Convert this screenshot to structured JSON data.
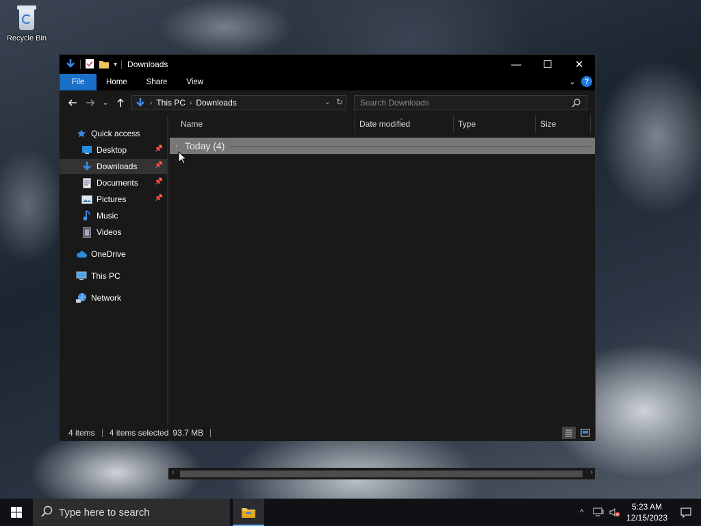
{
  "desktop": {
    "icons": [
      {
        "label": "Recycle Bin",
        "icon": "recycle-bin-icon"
      }
    ]
  },
  "window": {
    "title": "Downloads",
    "controls": {
      "minimize": "—",
      "maximize": "☐",
      "close": "✕"
    },
    "ribbon_tabs": [
      "File",
      "Home",
      "Share",
      "View"
    ],
    "help": "?",
    "address": {
      "crumbs": [
        "This PC",
        "Downloads"
      ]
    },
    "search": {
      "placeholder": "Search Downloads"
    },
    "nav": {
      "quick_access": "Quick access",
      "items": [
        {
          "label": "Desktop",
          "icon": "desktop-icon",
          "pinned": true
        },
        {
          "label": "Downloads",
          "icon": "downloads-icon",
          "pinned": true,
          "selected": true
        },
        {
          "label": "Documents",
          "icon": "documents-icon",
          "pinned": true
        },
        {
          "label": "Pictures",
          "icon": "pictures-icon",
          "pinned": true
        },
        {
          "label": "Music",
          "icon": "music-icon",
          "pinned": false
        },
        {
          "label": "Videos",
          "icon": "videos-icon",
          "pinned": false
        }
      ],
      "onedrive": "OneDrive",
      "this_pc": "This PC",
      "network": "Network"
    },
    "columns": [
      "Name",
      "Date modified",
      "Type",
      "Size"
    ],
    "group": {
      "label": "Today (4)"
    },
    "status": {
      "items": "4 items",
      "selected": "4 items selected",
      "size": "93.7 MB"
    }
  },
  "taskbar": {
    "search_placeholder": "Type here to search",
    "clock": {
      "time": "5:23 AM",
      "date": "12/15/2023"
    }
  },
  "colors": {
    "accent": "#1a6fc9",
    "window_bg": "#191919",
    "titlebar_bg": "#000000",
    "group_bg": "#777777",
    "taskbar_bg": "#101114"
  }
}
